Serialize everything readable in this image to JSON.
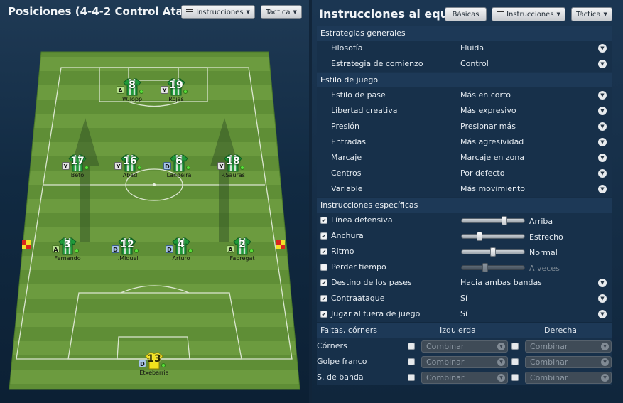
{
  "left": {
    "title": "Posiciones (4-4-2 Control Ata...",
    "instructions_btn": "Instrucciones",
    "tactica_btn": "Táctica"
  },
  "players": [
    {
      "number": "8",
      "name": "W.Topp",
      "role": "A"
    },
    {
      "number": "19",
      "name": "Rojas",
      "role": "Y"
    },
    {
      "number": "17",
      "name": "Beto",
      "role": "Y"
    },
    {
      "number": "16",
      "name": "Abad",
      "role": "Y"
    },
    {
      "number": "6",
      "name": "Landeira",
      "role": "D"
    },
    {
      "number": "18",
      "name": "P.Sauras",
      "role": "Y"
    },
    {
      "number": "3",
      "name": "Fernando",
      "role": "A"
    },
    {
      "number": "12",
      "name": "I.Miquel",
      "role": "D"
    },
    {
      "number": "4",
      "name": "Arturo",
      "role": "D"
    },
    {
      "number": "2",
      "name": "Fabregat",
      "role": "A"
    },
    {
      "number": "13",
      "name": "Etxebarria",
      "role": "D"
    }
  ],
  "right": {
    "title": "Instrucciones al equip",
    "basicas_btn": "Básicas",
    "instructions_btn": "Instrucciones",
    "tactica_btn": "Táctica"
  },
  "general": {
    "heading": "Estrategias generales",
    "rows": [
      {
        "label": "Filosofía",
        "value": "Fluida"
      },
      {
        "label": "Estrategia de comienzo",
        "value": "Control"
      }
    ]
  },
  "style": {
    "heading": "Estilo de juego",
    "rows": [
      {
        "label": "Estilo de pase",
        "value": "Más en corto"
      },
      {
        "label": "Libertad creativa",
        "value": "Más expresivo"
      },
      {
        "label": "Presión",
        "value": "Presionar más"
      },
      {
        "label": "Entradas",
        "value": "Más agresividad"
      },
      {
        "label": "Marcaje",
        "value": "Marcaje en zona"
      },
      {
        "label": "Centros",
        "value": "Por defecto"
      },
      {
        "label": "Variable",
        "value": "Más movimiento"
      }
    ]
  },
  "specific": {
    "heading": "Instrucciones específicas",
    "sliders": [
      {
        "label": "Línea defensiva",
        "checked": true,
        "value_label": "Arriba",
        "level": 0.68
      },
      {
        "label": "Anchura",
        "checked": true,
        "value_label": "Estrecho",
        "level": 0.28
      },
      {
        "label": "Ritmo",
        "checked": true,
        "value_label": "Normal",
        "level": 0.5
      },
      {
        "label": "Perder tiempo",
        "checked": false,
        "value_label": "A veces",
        "level": 0.38
      }
    ],
    "dropdowns": [
      {
        "label": "Destino de los pases",
        "checked": true,
        "value": "Hacia ambas bandas"
      },
      {
        "label": "Contraataque",
        "checked": true,
        "value": "Sí"
      },
      {
        "label": "Jugar al fuera de juego",
        "checked": true,
        "value": "Sí"
      }
    ]
  },
  "set_pieces": {
    "heading": "Faltas, córners",
    "left_col": "Izquierda",
    "right_col": "Derecha",
    "combo_placeholder": "Combinar",
    "rows": [
      {
        "label": "Córners"
      },
      {
        "label": "Golpe franco"
      },
      {
        "label": "S. de banda"
      }
    ]
  },
  "colors": {
    "pitch_light": "#6c9b3f",
    "pitch_dark": "#5a8a32",
    "shirt_green": "#1f9a3a",
    "gk_yellow": "#f2e21c"
  }
}
